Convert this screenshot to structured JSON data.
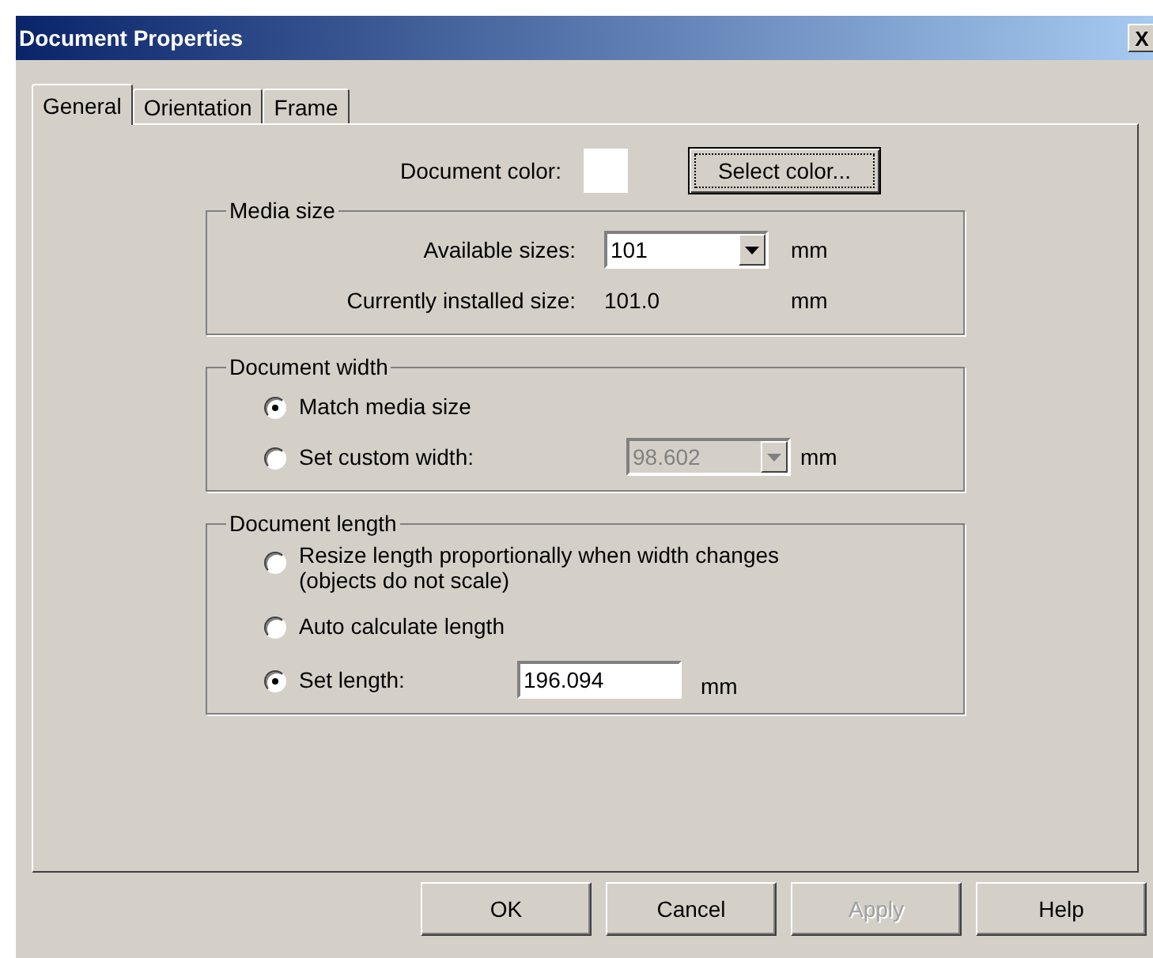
{
  "window": {
    "title": "Document Properties",
    "close": "X"
  },
  "tabs": [
    {
      "label": "General",
      "selected": true
    },
    {
      "label": "Orientation",
      "selected": false
    },
    {
      "label": "Frame",
      "selected": false
    }
  ],
  "document_color": {
    "label": "Document color:",
    "color": "#ffffff",
    "button": "Select color..."
  },
  "media_size": {
    "title": "Media size",
    "available_label": "Available sizes:",
    "available_value": "101",
    "available_unit": "mm",
    "installed_label": "Currently installed size:",
    "installed_value": "101.0",
    "installed_unit": "mm"
  },
  "document_width": {
    "title": "Document width",
    "options": [
      {
        "label": "Match media size",
        "selected": true
      },
      {
        "label": "Set custom width:",
        "selected": false
      }
    ],
    "custom_value": "98.602",
    "custom_disabled": true,
    "unit": "mm"
  },
  "document_length": {
    "title": "Document length",
    "options": [
      {
        "label": "Resize length proportionally when width changes",
        "label_line2": "(objects do not scale)",
        "selected": false
      },
      {
        "label": "Auto calculate length",
        "selected": false
      },
      {
        "label": "Set length:",
        "selected": true
      }
    ],
    "length_value": "196.094",
    "unit": "mm"
  },
  "buttons": [
    {
      "label": "OK",
      "disabled": false
    },
    {
      "label": "Cancel",
      "disabled": false
    },
    {
      "label": "Apply",
      "disabled": true
    },
    {
      "label": "Help",
      "disabled": false
    }
  ]
}
